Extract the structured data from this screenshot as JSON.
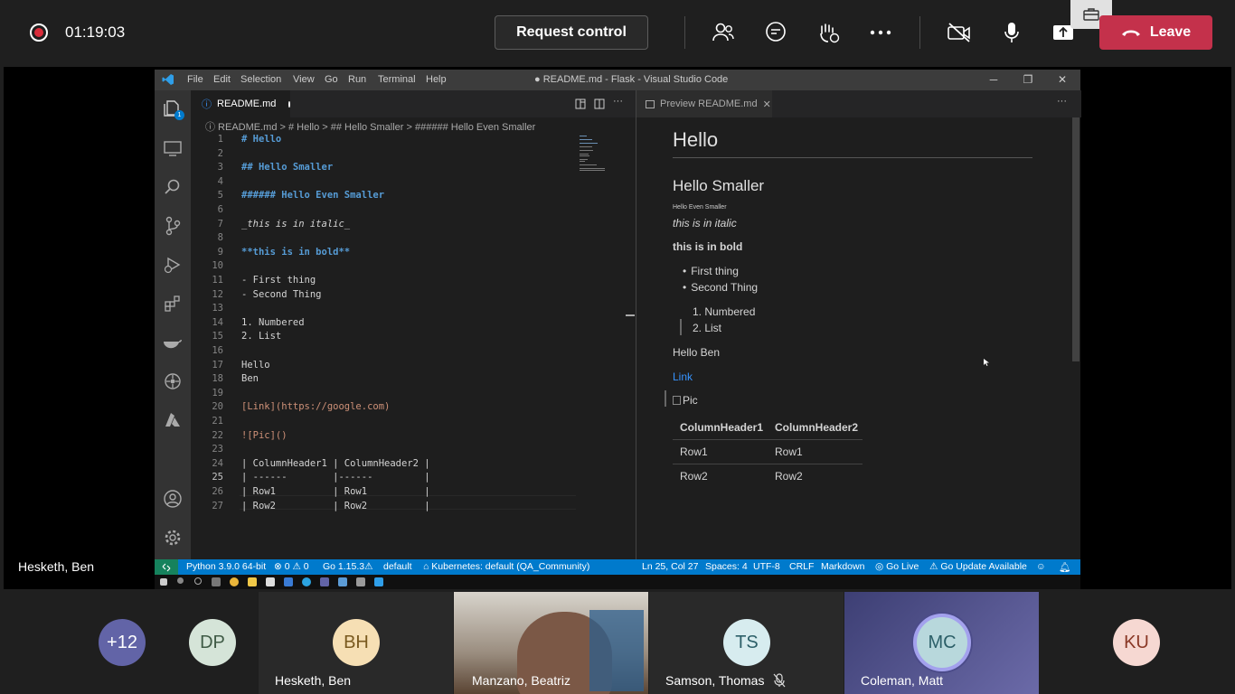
{
  "meeting": {
    "timer": "01:19:03",
    "request_control_label": "Request control",
    "leave_label": "Leave",
    "presenter_name": "Hesketh, Ben"
  },
  "vscode": {
    "menu": [
      "File",
      "Edit",
      "Selection",
      "View",
      "Go",
      "Run",
      "Terminal",
      "Help"
    ],
    "window_title": "● README.md - Flask - Visual Studio Code",
    "explorer_badge": "1",
    "left_tab_label": "README.md",
    "breadcrumb": "ⓘ README.md > # Hello > ## Hello Smaller > ###### Hello Even Smaller",
    "code_lines": [
      {
        "n": "1",
        "text": "# Hello",
        "style": "h"
      },
      {
        "n": "2",
        "text": "",
        "style": ""
      },
      {
        "n": "3",
        "text": "## Hello Smaller",
        "style": "h"
      },
      {
        "n": "4",
        "text": "",
        "style": ""
      },
      {
        "n": "5",
        "text": "###### Hello Even Smaller",
        "style": "h"
      },
      {
        "n": "6",
        "text": "",
        "style": ""
      },
      {
        "n": "7",
        "text": "_this is in italic_",
        "style": "it"
      },
      {
        "n": "8",
        "text": "",
        "style": ""
      },
      {
        "n": "9",
        "text": "**this is in bold**",
        "style": "md-bold"
      },
      {
        "n": "10",
        "text": "",
        "style": ""
      },
      {
        "n": "11",
        "text": "- First thing",
        "style": "list"
      },
      {
        "n": "12",
        "text": "- Second Thing",
        "style": "list"
      },
      {
        "n": "13",
        "text": "",
        "style": ""
      },
      {
        "n": "14",
        "text": "1. Numbered",
        "style": "list"
      },
      {
        "n": "15",
        "text": "2. List",
        "style": "list"
      },
      {
        "n": "16",
        "text": "",
        "style": ""
      },
      {
        "n": "17",
        "text": "Hello",
        "style": ""
      },
      {
        "n": "18",
        "text": "Ben",
        "style": ""
      },
      {
        "n": "19",
        "text": "",
        "style": ""
      },
      {
        "n": "20",
        "text": "[Link](https://google.com)",
        "style": "link"
      },
      {
        "n": "21",
        "text": "",
        "style": ""
      },
      {
        "n": "22",
        "text": "![Pic]()",
        "style": "pic"
      },
      {
        "n": "23",
        "text": "",
        "style": ""
      },
      {
        "n": "24",
        "text": "| ColumnHeader1 | ColumnHeader2 |",
        "style": ""
      },
      {
        "n": "25",
        "text": "| ------        |------         |",
        "style": ""
      },
      {
        "n": "26",
        "text": "| Row1          | Row1          |",
        "style": ""
      },
      {
        "n": "27",
        "text": "| Row2          | Row2          |",
        "style": ""
      }
    ],
    "preview_tab_label": "Preview README.md",
    "preview": {
      "h1": "Hello",
      "h2": "Hello Smaller",
      "h6": "Hello Even Smaller",
      "italic": "this is in italic",
      "bold": "this is in bold",
      "bullets": [
        "First thing",
        "Second Thing"
      ],
      "numbered": [
        "1. Numbered",
        "2. List"
      ],
      "text": "Hello Ben",
      "link": "Link",
      "pic": "Pic",
      "table": {
        "headers": [
          "ColumnHeader1",
          "ColumnHeader2"
        ],
        "rows": [
          [
            "Row1",
            "Row1"
          ],
          [
            "Row2",
            "Row2"
          ]
        ]
      }
    },
    "status": {
      "python": "Python 3.9.0 64-bit",
      "problems": "⊗ 0 ⚠ 0",
      "go": "Go 1.15.3⚠",
      "env": "default",
      "kubernetes": "Kubernetes: default (QA_Community)",
      "cursor": "Ln 25, Col 27",
      "spaces": "Spaces: 4",
      "encoding": "UTF-8",
      "eol": "CRLF",
      "language": "Markdown",
      "golive": "Go Live",
      "goupdate": "Go Update Available"
    }
  },
  "participants": {
    "overflow": "+12",
    "dp": "DP",
    "bh": "BH",
    "bh_name": "Hesketh, Ben",
    "manzano_name": "Manzano, Beatriz",
    "ts": "TS",
    "ts_name": "Samson, Thomas",
    "mc": "MC",
    "mc_name": "Coleman, Matt",
    "ku": "KU"
  }
}
